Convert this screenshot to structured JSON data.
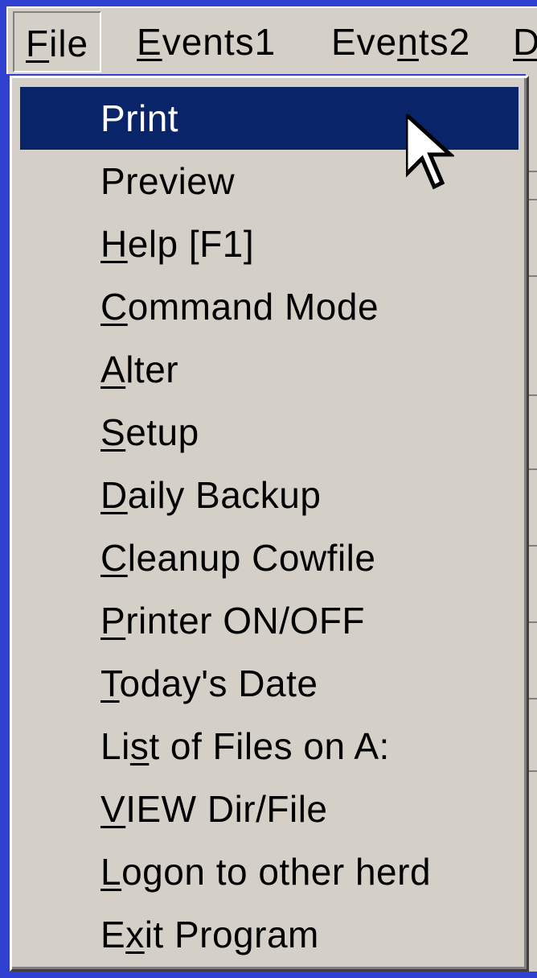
{
  "menubar": {
    "items": [
      {
        "label": "File",
        "mnemonic": "F",
        "rest": "ile"
      },
      {
        "label": "Events1",
        "mnemonic": "E",
        "rest": "vents1"
      },
      {
        "label": "Events2",
        "pre": "Eve",
        "mnemonic": "n",
        "rest": "ts2"
      },
      {
        "label": "D",
        "mnemonic": "D",
        "rest": ""
      }
    ]
  },
  "file_menu": {
    "items": [
      {
        "label": "Print",
        "pre": "",
        "mnemonic": "",
        "rest": "Print",
        "highlighted": true
      },
      {
        "label": "Preview",
        "pre": "",
        "mnemonic": "",
        "rest": "Preview"
      },
      {
        "label": "Help [F1]",
        "pre": "",
        "mnemonic": "H",
        "rest": "elp [F1]"
      },
      {
        "label": "Command Mode",
        "pre": "",
        "mnemonic": "C",
        "rest": "ommand Mode"
      },
      {
        "label": "Alter",
        "pre": "",
        "mnemonic": "A",
        "rest": "lter"
      },
      {
        "label": "Setup",
        "pre": "",
        "mnemonic": "S",
        "rest": "etup"
      },
      {
        "label": "Daily Backup",
        "pre": "",
        "mnemonic": "D",
        "rest": "aily Backup"
      },
      {
        "label": "Cleanup Cowfile",
        "pre": "",
        "mnemonic": "C",
        "rest": "leanup Cowfile"
      },
      {
        "label": "Printer ON/OFF",
        "pre": "",
        "mnemonic": "P",
        "rest": "rinter ON/OFF"
      },
      {
        "label": "Today's Date",
        "pre": "",
        "mnemonic": "T",
        "rest": "oday's Date"
      },
      {
        "label": "List of Files on A:",
        "pre": "Li",
        "mnemonic": "s",
        "rest": "t of Files on A:"
      },
      {
        "label": "VIEW Dir/File",
        "pre": "",
        "mnemonic": "V",
        "rest": "IEW Dir/File"
      },
      {
        "label": "Logon to other herd",
        "pre": "",
        "mnemonic": "L",
        "rest": "ogon to other herd"
      },
      {
        "label": "Exit Program",
        "pre": "E",
        "mnemonic": "x",
        "rest": "it Program"
      }
    ]
  },
  "colors": {
    "desktop": "#2f3fd0",
    "face": "#d4d0c8",
    "highlight": "#0a246a",
    "highlight_text": "#ffffff"
  },
  "icons": {
    "cursor": "mouse-pointer-arrow-icon"
  }
}
